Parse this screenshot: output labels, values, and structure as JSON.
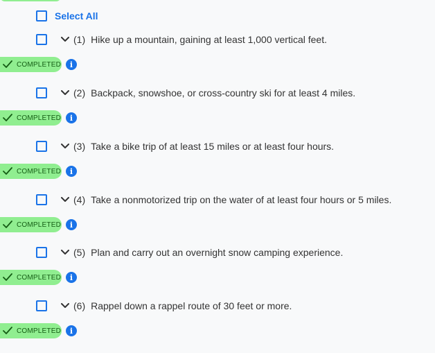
{
  "select_all_label": "Select All",
  "status_label": "COMPLETED",
  "info_glyph": "i",
  "icons": {
    "checkbox": "checkbox-icon",
    "chevron": "chevron-down-icon",
    "check": "check-icon",
    "info": "info-icon"
  },
  "colors": {
    "accent": "#1a73e8",
    "completed_bg": "#90ee90",
    "completed_text": "#145c14",
    "background": "#f8f9fa"
  },
  "requirements": [
    {
      "num": "(1)",
      "text": "Hike up a mountain, gaining at least 1,000 vertical feet.",
      "status": "COMPLETED"
    },
    {
      "num": "(2)",
      "text": "Backpack, snowshoe, or cross-country ski for at least 4 miles.",
      "status": "COMPLETED"
    },
    {
      "num": "(3)",
      "text": "Take a bike trip of at least 15 miles or at least four hours.",
      "status": "COMPLETED"
    },
    {
      "num": "(4)",
      "text": "Take a nonmotorized trip on the water of at least four hours or 5 miles.",
      "status": "COMPLETED"
    },
    {
      "num": "(5)",
      "text": "Plan and carry out an overnight snow camping experience.",
      "status": "COMPLETED"
    },
    {
      "num": "(6)",
      "text": "Rappel down a rappel route of 30 feet or more.",
      "status": "COMPLETED"
    }
  ]
}
